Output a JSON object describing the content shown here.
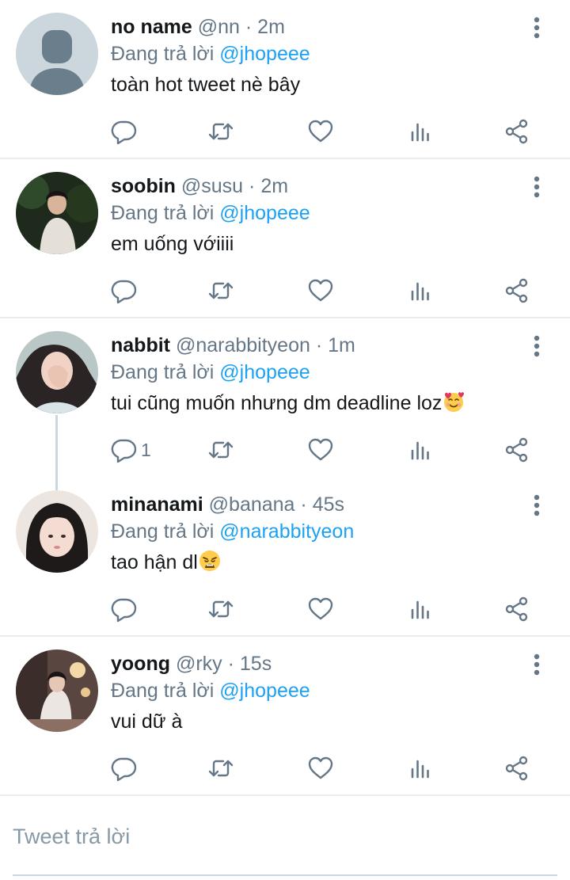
{
  "reply_prefix": "Đang trả lời",
  "tweets": [
    {
      "name": "no name",
      "handle": "@nn",
      "time": "2m",
      "replying_to": "@jhopeee",
      "text": "toàn hot tweet nè bây",
      "reply_count": "",
      "avatar": "default-avatar"
    },
    {
      "name": "soobin",
      "handle": "@susu",
      "time": "2m",
      "replying_to": "@jhopeee",
      "text": "em uống vớiiii",
      "reply_count": "",
      "avatar": "photo-avatar"
    },
    {
      "name": "nabbit",
      "handle": "@narabbityeon",
      "time": "1m",
      "replying_to": "@jhopeee",
      "text": "tui cũng muốn nhưng dm deadline loz",
      "emoji": "smiling-face-with-hearts",
      "reply_count": "1",
      "avatar": "photo-avatar"
    },
    {
      "name": "minanami",
      "handle": "@banana",
      "time": "45s",
      "replying_to": "@narabbityeon",
      "text": "tao hận dl",
      "emoji": "weary-face",
      "reply_count": "",
      "avatar": "photo-avatar"
    },
    {
      "name": "yoong",
      "handle": "@rky",
      "time": "15s",
      "replying_to": "@jhopeee",
      "text": "vui dữ à",
      "reply_count": "",
      "avatar": "photo-avatar"
    }
  ],
  "composer": {
    "placeholder": "Tweet trả lời"
  },
  "colors": {
    "mention": "#1da1f2",
    "secondary_text": "#657786",
    "divider": "#e6ecf0"
  }
}
